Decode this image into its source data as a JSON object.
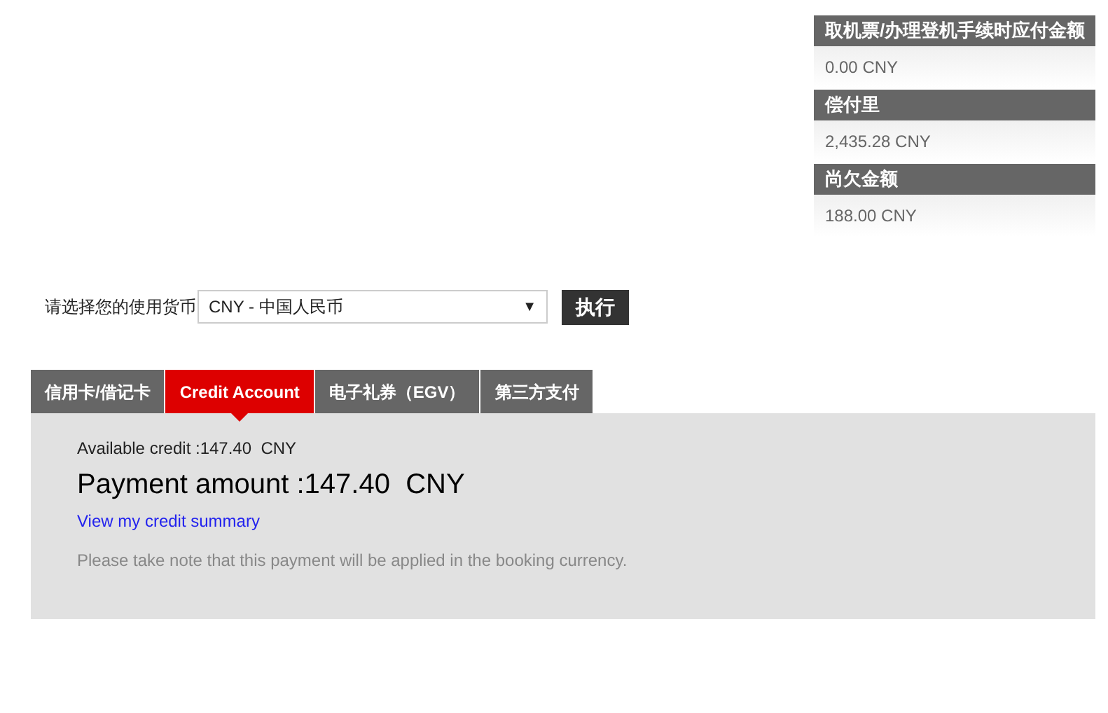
{
  "summary": [
    {
      "label": "取机票/办理登机手续时应付金额",
      "value": "0.00 CNY"
    },
    {
      "label": "偿付里",
      "value": "2,435.28 CNY"
    },
    {
      "label": "尚欠金额",
      "value": "188.00 CNY"
    }
  ],
  "currency": {
    "label": "请选择您的使用货币",
    "value": "CNY - 中国人民币",
    "arrow": "▼",
    "button": "执行"
  },
  "tabs": [
    {
      "label": "信用卡/借记卡",
      "selected": false
    },
    {
      "label": "Credit Account",
      "selected": true
    },
    {
      "label": "电子礼券（EGV）",
      "selected": false
    },
    {
      "label": "第三方支付",
      "selected": false
    }
  ],
  "panel": {
    "available": "Available credit :147.40  CNY",
    "payment": "Payment amount :147.40  CNY",
    "link": "View my credit summary",
    "note": "Please take note that this payment will be applied in the booking currency."
  }
}
